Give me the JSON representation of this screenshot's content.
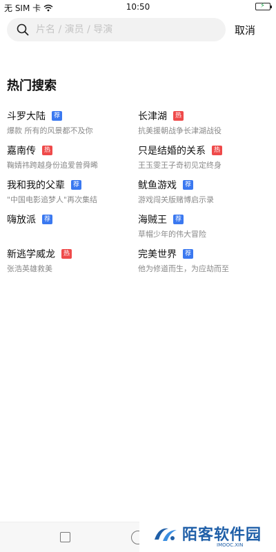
{
  "status_bar": {
    "carrier": "无 SIM 卡",
    "time": "10:50",
    "icons": [
      "wifi-icon",
      "battery-icon"
    ]
  },
  "search": {
    "placeholder": "片名 / 演员 / 导演",
    "value": "",
    "cancel_label": "取消"
  },
  "hot_search": {
    "title": "热门搜索",
    "items": [
      {
        "title": "斗罗大陆",
        "badge": "荐",
        "badge_type": "rec",
        "subtitle": "爆款 所有的风景都不及你"
      },
      {
        "title": "长津湖",
        "badge": "热",
        "badge_type": "hot",
        "subtitle": "抗美援朝战争长津湖战役"
      },
      {
        "title": "嘉南传",
        "badge": "热",
        "badge_type": "hot",
        "subtitle": "鞠婧祎跨越身份追爱曾舜晞"
      },
      {
        "title": "只是结婚的关系",
        "badge": "热",
        "badge_type": "hot",
        "subtitle": "王玉雯王子奇初见定终身"
      },
      {
        "title": "我和我的父辈",
        "badge": "荐",
        "badge_type": "rec",
        "subtitle": "\"中国电影追梦人\"再次集结"
      },
      {
        "title": "鱿鱼游戏",
        "badge": "荐",
        "badge_type": "rec",
        "subtitle": "游戏闯关版赌博启示录"
      },
      {
        "title": "嗨放派",
        "badge": "荐",
        "badge_type": "rec",
        "subtitle": ""
      },
      {
        "title": "海贼王",
        "badge": "荐",
        "badge_type": "rec",
        "subtitle": "草帽少年的伟大冒险"
      },
      {
        "title": "新逃学威龙",
        "badge": "热",
        "badge_type": "hot",
        "subtitle": "张浩英雄救美"
      },
      {
        "title": "完美世界",
        "badge": "荐",
        "badge_type": "rec",
        "subtitle": "他为修道而生，为应劫而至"
      }
    ]
  },
  "watermark": {
    "name": "陌客软件园",
    "domain": "IMOOC.XIN"
  },
  "colors": {
    "rec_badge": "#3a78f0",
    "hot_badge": "#ef4a4a",
    "search_bg": "#f2f2f2"
  }
}
